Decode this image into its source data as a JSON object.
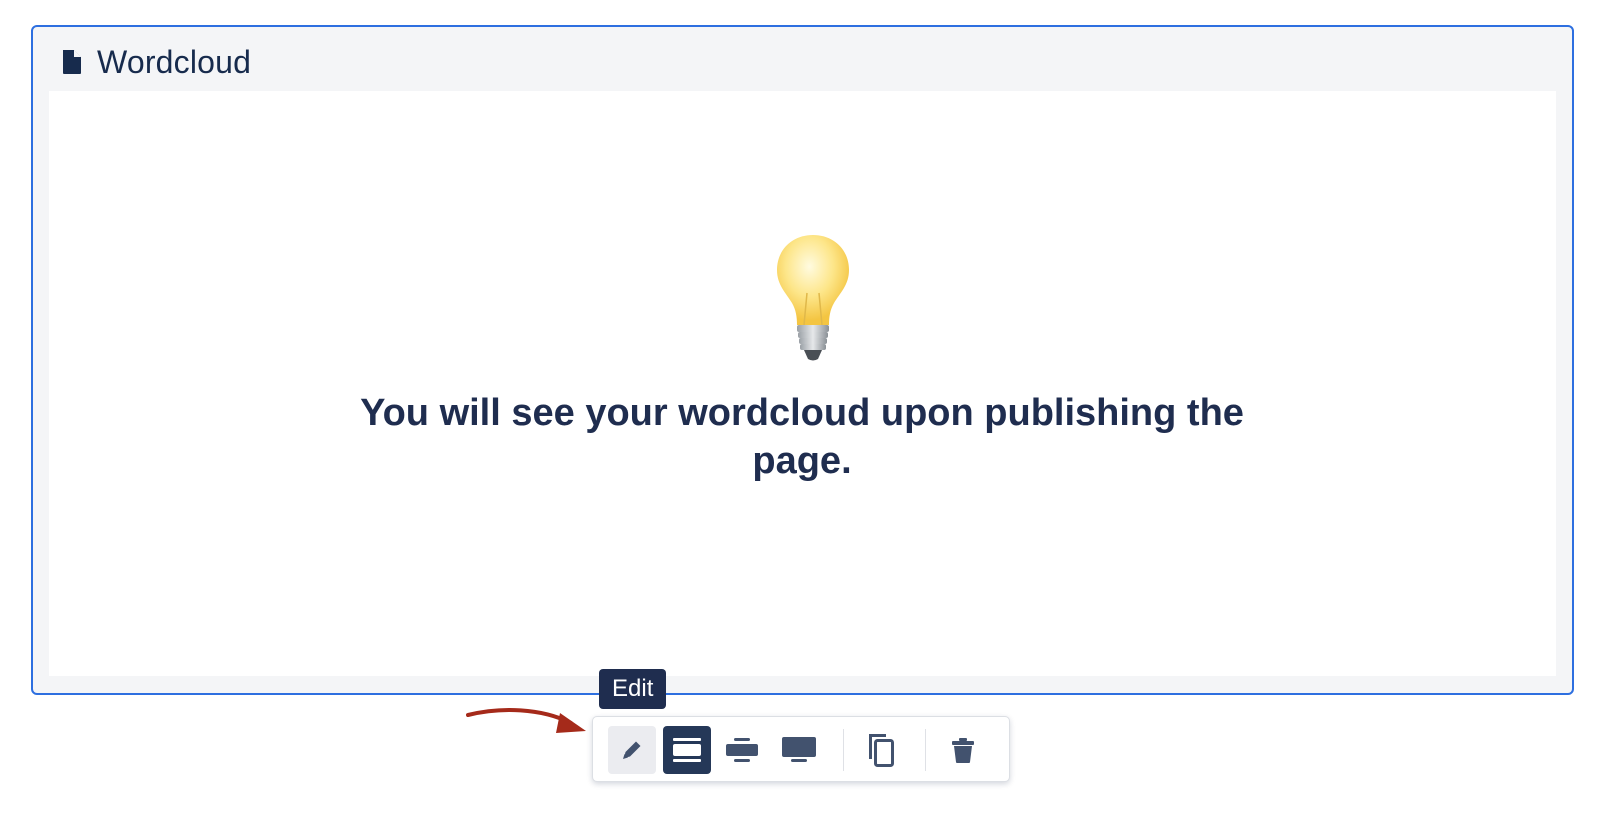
{
  "macro": {
    "title": "Wordcloud",
    "icon": "document-icon",
    "placeholder_icon": "lightbulb-icon",
    "placeholder_text": "You will see your wordcloud upon publishing the page."
  },
  "tooltip": {
    "text": "Edit"
  },
  "toolbar": {
    "buttons": [
      {
        "name": "edit",
        "icon": "pencil-icon",
        "state": "hovered"
      },
      {
        "name": "full-width",
        "icon": "full-width-icon",
        "state": "selected"
      },
      {
        "name": "center",
        "icon": "center-align-icon",
        "state": "default"
      },
      {
        "name": "wide",
        "icon": "monitor-icon",
        "state": "default"
      },
      {
        "name": "copy",
        "icon": "copy-icon",
        "state": "default"
      },
      {
        "name": "delete",
        "icon": "trash-icon",
        "state": "default"
      }
    ]
  },
  "colors": {
    "selection_border": "#2d6fe0",
    "text_dark": "#1f2d4f",
    "selected_button": "#253858",
    "annotation_arrow": "#a52a1a"
  }
}
